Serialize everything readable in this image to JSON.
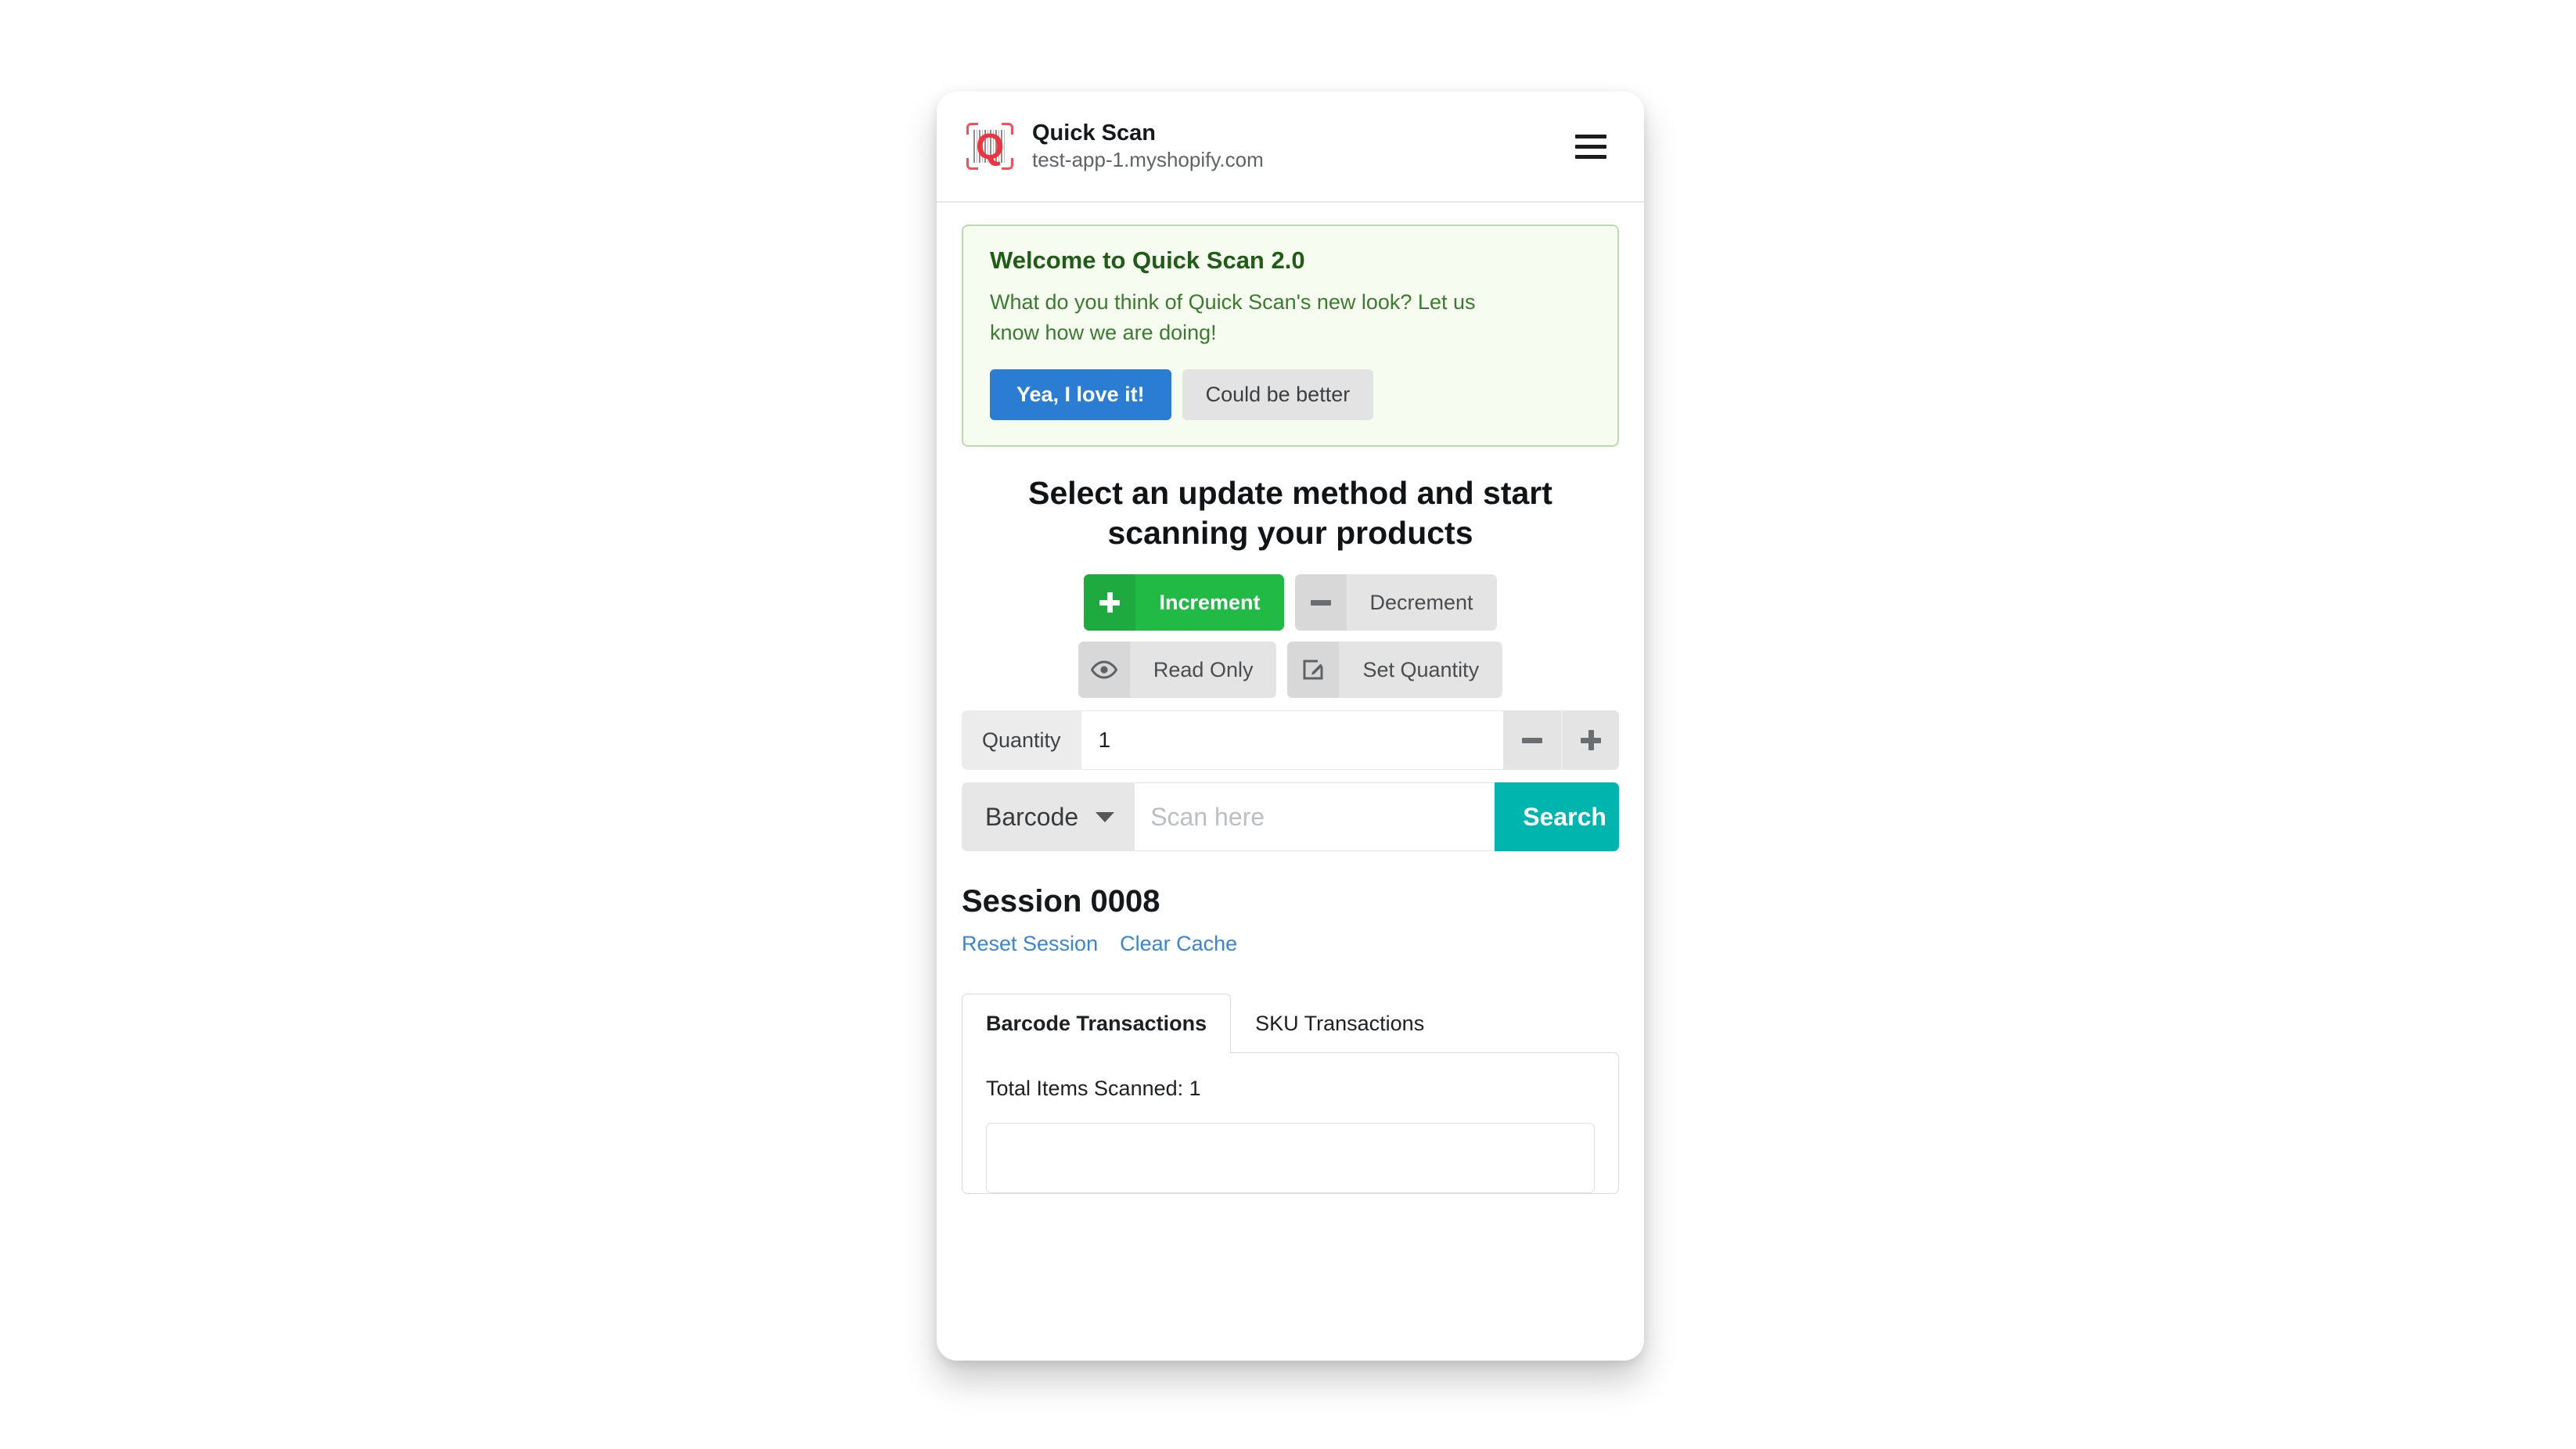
{
  "header": {
    "app_title": "Quick Scan",
    "shop_domain": "test-app-1.myshopify.com",
    "logo_letter": "Q",
    "menu_icon": "hamburger-menu-icon"
  },
  "banner": {
    "title": "Welcome to Quick Scan 2.0",
    "message": "What do you think of Quick Scan's new look? Let us know how we are doing!",
    "primary_label": "Yea, I love it!",
    "secondary_label": "Could be better",
    "accent": "#2b7cd3",
    "background": "#f7fcf0",
    "border": "#bcd9b0",
    "title_color": "#1f5c16"
  },
  "main": {
    "heading": "Select an update method and start scanning your products"
  },
  "methods": [
    {
      "label": "Increment",
      "icon": "plus-icon",
      "selected": true
    },
    {
      "label": "Decrement",
      "icon": "minus-icon",
      "selected": false
    },
    {
      "label": "Read Only",
      "icon": "eye-icon",
      "selected": false
    },
    {
      "label": "Set Quantity",
      "icon": "edit-square-icon",
      "selected": false
    }
  ],
  "quantity": {
    "label": "Quantity",
    "value": "1",
    "decrement_icon": "minus-icon",
    "increment_icon": "plus-icon"
  },
  "search": {
    "mode": "Barcode",
    "mode_icon": "chevron-down-icon",
    "placeholder": "Scan here",
    "value": "",
    "button_label": "Search",
    "button_color": "#00b5ad"
  },
  "session": {
    "title": "Session 0008",
    "reset_label": "Reset Session",
    "clear_cache_label": "Clear Cache",
    "link_color": "#3a84d6"
  },
  "tabs": [
    {
      "label": "Barcode Transactions",
      "active": true
    },
    {
      "label": "SKU Transactions",
      "active": false
    }
  ],
  "panel": {
    "summary": "Total Items Scanned: 1"
  }
}
